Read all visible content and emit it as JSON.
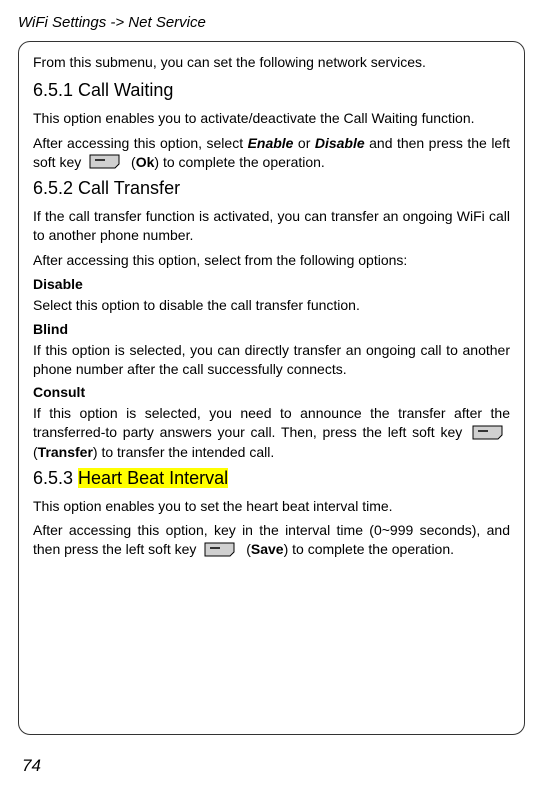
{
  "header": "WiFi Settings -> Net Service",
  "intro": "From this submenu, you can set the following network services.",
  "s651": {
    "heading": "6.5.1 Call Waiting",
    "p1": "This option enables you to activate/deactivate the Call Waiting function.",
    "p2a": "After accessing this option, select ",
    "enable": "Enable",
    "or": " or ",
    "disable": "Disable",
    "p2b": " and then press the left soft key ",
    "p2c": " (",
    "ok": "Ok",
    "p2d": ") to complete the operation."
  },
  "s652": {
    "heading": "6.5.2 Call Transfer",
    "p1": "If the call transfer function is activated, you can transfer an ongoing WiFi call to another phone number.",
    "p2": "After accessing this option, select from the following options:",
    "disable_h": "Disable",
    "disable_p": "Select this option to disable the call transfer function.",
    "blind_h": "Blind",
    "blind_p": "If this option is selected, you can directly transfer an ongoing call to another phone number after the call successfully connects.",
    "consult_h": "Consult",
    "consult_p1": "If this option is selected, you need to announce the transfer after the transferred-to party answers your call. Then, press the left soft key ",
    "consult_p2a": " (",
    "transfer": "Transfer",
    "consult_p2b": ") to transfer the intended call."
  },
  "s653": {
    "heading_prefix": "6.5.3 ",
    "heading_hl": "Heart Beat Interval",
    "p1": "This option enables you to set the heart beat interval time.",
    "p2a": "After accessing this option, key in the interval time (0~999 seconds), and then press the left soft key ",
    "p2b": " (",
    "save": "Save",
    "p2c": ") to complete the operation."
  },
  "page_num": "74"
}
